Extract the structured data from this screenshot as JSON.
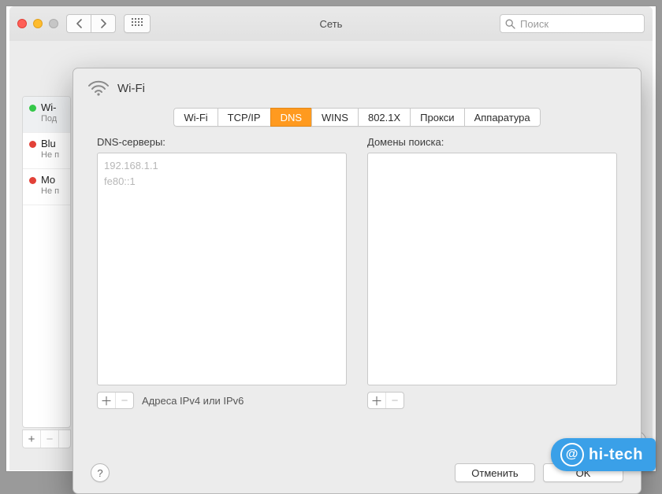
{
  "window": {
    "title": "Сеть",
    "search_placeholder": "Поиск"
  },
  "sidebar": {
    "items": [
      {
        "name": "Wi-",
        "status": "Под",
        "color": "green",
        "selected": true
      },
      {
        "name": "Blu",
        "status": "Не п",
        "color": "red",
        "selected": false
      },
      {
        "name": "Mo",
        "status": "Не п",
        "color": "red",
        "selected": false
      }
    ]
  },
  "sheet": {
    "title": "Wi-Fi",
    "tabs": [
      "Wi-Fi",
      "TCP/IP",
      "DNS",
      "WINS",
      "802.1X",
      "Прокси",
      "Аппаратура"
    ],
    "active_tab": 2,
    "dns": {
      "servers_label": "DNS-серверы:",
      "servers": [
        "192.168.1.1",
        "fe80::1"
      ],
      "add_hint": "Адреса IPv4 или IPv6",
      "domains_label": "Домены поиска:",
      "domains": []
    },
    "buttons": {
      "cancel": "Отменить",
      "ok": "OK"
    }
  },
  "watermark": "hi-tech"
}
